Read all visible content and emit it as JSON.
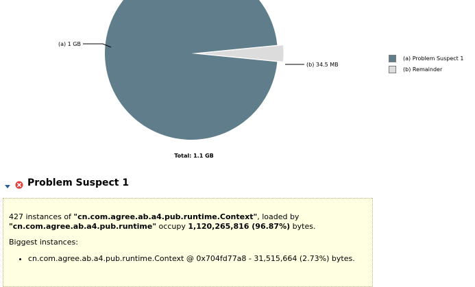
{
  "chart_data": {
    "type": "pie",
    "slices": [
      {
        "label": "(a) 1 GB",
        "legend": "(a) Problem Suspect 1",
        "value": 1120265816,
        "color": "#5f7d8a"
      },
      {
        "label": "(b) 34.5 MB",
        "legend": "(b) Remainder",
        "value": 36178184,
        "color": "#dcdcdc"
      }
    ],
    "total_label": "Total: 1.1 GB"
  },
  "section": {
    "title": "Problem Suspect 1",
    "toggle_icon": "chevron-down-icon",
    "status_icon": "error-icon"
  },
  "suspect": {
    "count_text": "427 instances of ",
    "class_name": "\"cn.com.agree.ab.a4.pub.runtime.Context\"",
    "loaded_by_text": ", loaded by",
    "loader_name": "\"cn.com.agree.ab.a4.pub.runtime\"",
    "occupy_text": " occupy ",
    "bytes_value": "1,120,265,816 (96.87%)",
    "bytes_suffix": " bytes.",
    "biggest_label": "Biggest instances:",
    "instances": [
      "cn.com.agree.ab.a4.pub.runtime.Context @ 0x704fd77a8 - 31,515,664 (2.73%) bytes."
    ]
  }
}
